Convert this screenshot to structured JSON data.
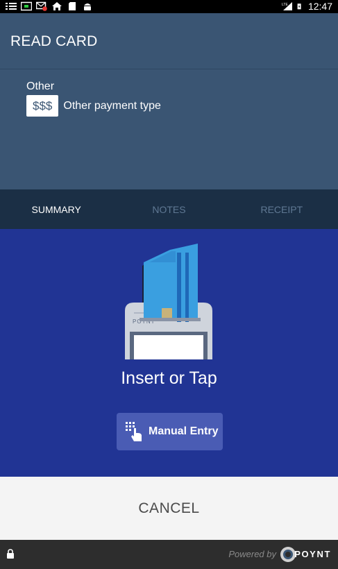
{
  "status_bar": {
    "time": "12:47",
    "network": "LTE",
    "icons": [
      "list-icon",
      "screen-icon",
      "mail-error-icon",
      "home-icon",
      "sd-card-icon",
      "android-icon",
      "signal-icon",
      "battery-charging-icon"
    ]
  },
  "header": {
    "title": "READ CARD",
    "payment_label": "Other",
    "payment_badge": "$$$",
    "payment_type": "Other payment type"
  },
  "tabs": [
    {
      "label": "SUMMARY",
      "active": true
    },
    {
      "label": "NOTES",
      "active": false
    },
    {
      "label": "RECEIPT",
      "active": false
    }
  ],
  "main": {
    "illustration_brand": "POYNT",
    "prompt": "Insert or Tap",
    "manual_entry_label": "Manual Entry"
  },
  "cancel_label": "CANCEL",
  "footer": {
    "powered_by": "Powered by",
    "brand": "POYNT"
  },
  "colors": {
    "header_bg": "#3a5573",
    "tabs_bg": "#1b2f45",
    "main_bg": "#213494",
    "button_bg": "#4a5cb4",
    "cancel_bg": "#f4f4f4",
    "footer_bg": "#2d2d2d"
  }
}
